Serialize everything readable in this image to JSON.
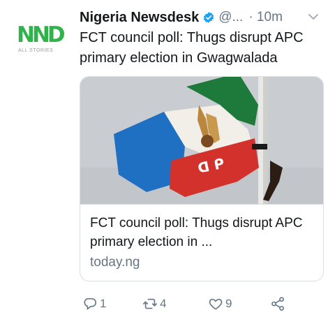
{
  "avatar": {
    "logo_text": "NND",
    "logo_subtext": "ALL STORIES",
    "icon": "nnd-logo"
  },
  "tweet": {
    "author_name": "Nigeria Newsdesk",
    "verified_icon": "verified-badge-icon",
    "handle": "@...",
    "timestamp": "· 10m",
    "text": "FCT council poll: Thugs disrupt APC primary election in Gwagwalada"
  },
  "card": {
    "image_icon": "apc-flag-photo",
    "title": "FCT council poll: Thugs disrupt APC primary election in ...",
    "domain": "today.ng"
  },
  "actions": {
    "reply": {
      "icon": "reply-icon",
      "count": "1"
    },
    "retweet": {
      "icon": "retweet-icon",
      "count": "4"
    },
    "like": {
      "icon": "heart-icon",
      "count": "9"
    },
    "share": {
      "icon": "share-icon"
    }
  },
  "colors": {
    "brand_green": "#2fb34a",
    "verified_blue": "#1da1f2",
    "muted": "#657786",
    "text": "#14171a",
    "border": "#d8dee3"
  }
}
